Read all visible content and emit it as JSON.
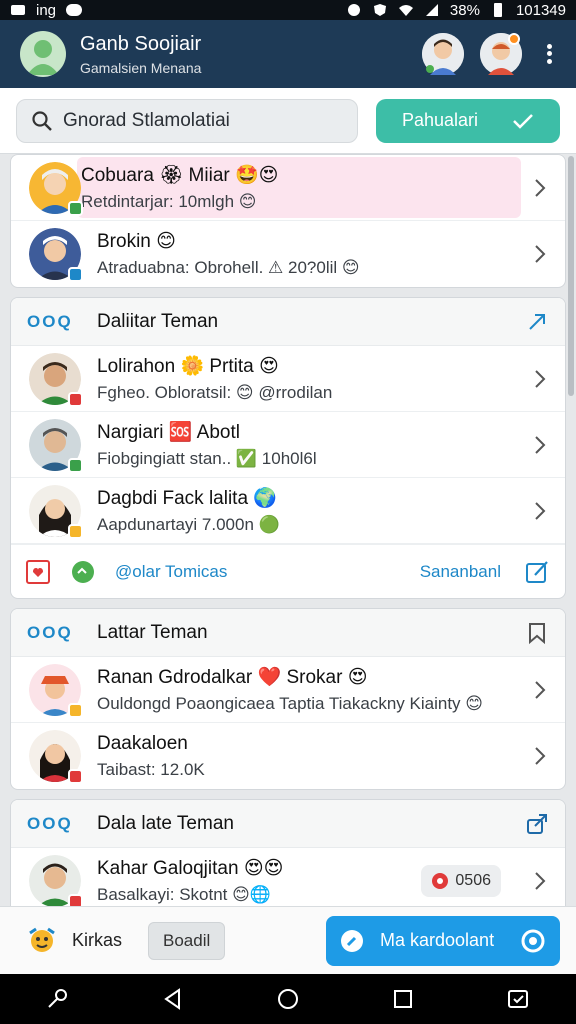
{
  "status_bar": {
    "left_text": "ing",
    "battery": "38%",
    "time": "101349"
  },
  "header": {
    "title": "Ganb Soojiair",
    "subtitle": "Gamalsien Menana"
  },
  "search": {
    "placeholder": "Gnorad Stlamolatiai"
  },
  "filter_button": {
    "label": "Pahualari"
  },
  "top_card": {
    "rows": [
      {
        "name": "Cobuara 🏵 Miiar 🤩😍",
        "sub": "Retdintarjar: 10mlgh 😊",
        "highlight": true
      },
      {
        "name": "Brokin 😊",
        "sub": "Atraduabna: Obrohell. ⚠ 20?0lil 😊",
        "highlight": false
      }
    ]
  },
  "section1": {
    "badge": "OOQ",
    "title": "Daliitar Teman",
    "rows": [
      {
        "name": "Lolirahon 🌼 Prtita 😍",
        "sub": "Fgheo. Obloratsil: 😊 @rrodilan"
      },
      {
        "name": "Nargiari 🆘 Abotl",
        "sub": "Fiobgingiatt stan.. ✅ 10h0l6l"
      },
      {
        "name": "Dagbdi Fack lalita 🌍",
        "sub": "Aapdunartayi 7.000n 🟢"
      }
    ],
    "footer_link": "@olar Tomicas",
    "footer_right": "Sananbanl"
  },
  "section2": {
    "badge": "OOQ",
    "title": "Lattar Teman",
    "rows": [
      {
        "name": "Ranan Gdrodalkar ❤️ Srokar 😍",
        "sub": "Ouldongd Poaongicaea Taptia Tiakackny Kiainty 😊"
      },
      {
        "name": "Daakaloen",
        "sub": "Taibast: 12.0K"
      }
    ]
  },
  "section3": {
    "badge": "OOQ",
    "title": "Dala late Teman",
    "rows": [
      {
        "name": "Kahar Galoqjitan 😍😍",
        "sub": "Basalkayi: Skotnt 😊🌐",
        "pill": "0506"
      }
    ]
  },
  "bottom_bar": {
    "left_label": "Kirkas",
    "ghost_label": "Boadil",
    "primary_label": "Ma kardoolant"
  },
  "colors": {
    "header": "#1e3a56",
    "accent_teal": "#3dbea7",
    "accent_blue": "#1e9be6",
    "link_blue": "#1e88c8"
  }
}
